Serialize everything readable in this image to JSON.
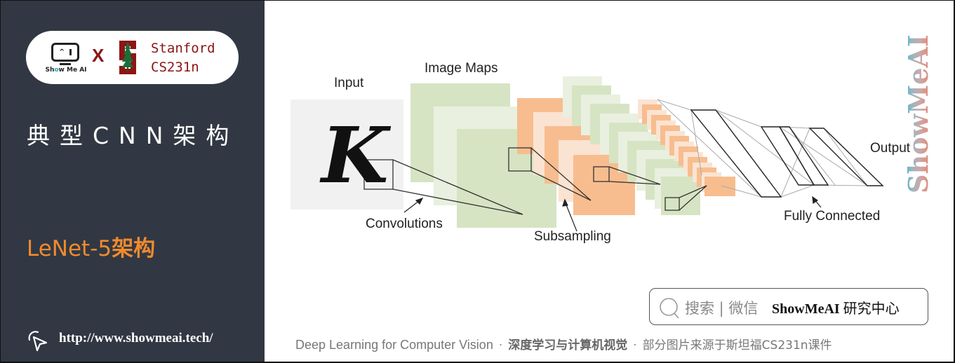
{
  "left_panel": {
    "logo": {
      "showmeai_text_pre": "Sh",
      "showmeai_text_o": "o",
      "showmeai_text_post": "w Me AI",
      "times_symbol": "X",
      "stanford_line1": "Stanford",
      "stanford_line2": "CS231n"
    },
    "title": "典型CNN架构",
    "subtitle_en": "LeNet-5",
    "subtitle_cn": "架构",
    "url": "http://www.showmeai.tech/",
    "icons": {
      "cursor": "cursor-click-icon",
      "monitor": "showmeai-monitor-icon",
      "stanford": "stanford-s-tree-icon"
    }
  },
  "diagram": {
    "labels": {
      "input": "Input",
      "image_maps": "Image Maps",
      "convolutions": "Convolutions",
      "subsampling": "Subsampling",
      "fully_connected": "Fully Connected",
      "output": "Output"
    },
    "input_glyph": "K",
    "colors": {
      "input_bg": "#f1f1f1",
      "green_dark": "#d6e4c3",
      "green_light": "#e9f0df",
      "orange_dark": "#f7bd8f",
      "orange_light": "#fbe3d2"
    }
  },
  "watermark": {
    "text": "ShowMeAI"
  },
  "search_box": {
    "icon": "search-icon",
    "label": "搜索 | 微信",
    "brand": "ShowMeAI",
    "brand_cn": "研究中心"
  },
  "footer": {
    "course_en": "Deep Learning for Computer Vision",
    "separator": "·",
    "course_cn": "深度学习与计算机视觉",
    "credit": "部分图片来源于斯坦福CS231n课件"
  }
}
